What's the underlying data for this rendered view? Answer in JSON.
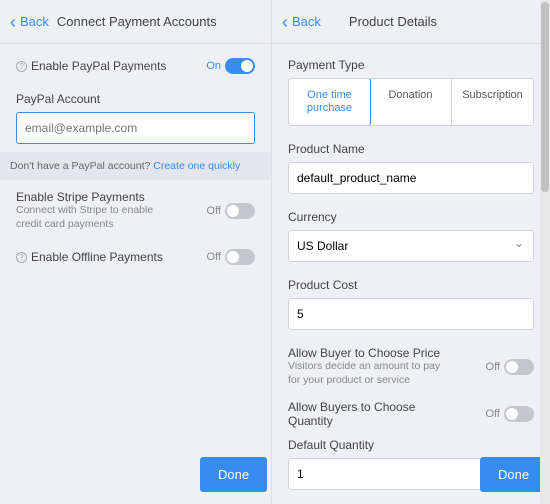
{
  "left": {
    "back": "Back",
    "title": "Connect Payment Accounts",
    "paypal_enable": "Enable PayPal Payments",
    "on": "On",
    "off": "Off",
    "paypal_account": "PayPal Account",
    "email_ph": "email@example.com",
    "hint_pre": "Don't have a PayPal account?  ",
    "hint_link": "Create one quickly",
    "stripe": "Enable Stripe Payments",
    "stripe_sub": "Connect with Stripe to enable credit card payments",
    "offline": "Enable Offline Payments",
    "done": "Done"
  },
  "right": {
    "back": "Back",
    "title": "Product Details",
    "payment_type": "Payment Type",
    "seg": [
      "One time purchase",
      "Donation",
      "Subscription"
    ],
    "product_name": "Product Name",
    "product_name_val": "default_product_name",
    "currency": "Currency",
    "currency_val": "US Dollar",
    "cost": "Product Cost",
    "cost_val": "5",
    "allow_price": "Allow Buyer to Choose Price",
    "allow_price_sub": "Visitors decide an amount to pay for your product or service",
    "allow_qty": "Allow Buyers to Choose Quantity",
    "def_qty": "Default Quantity",
    "def_qty_val": "1",
    "off": "Off",
    "done": "Done"
  }
}
